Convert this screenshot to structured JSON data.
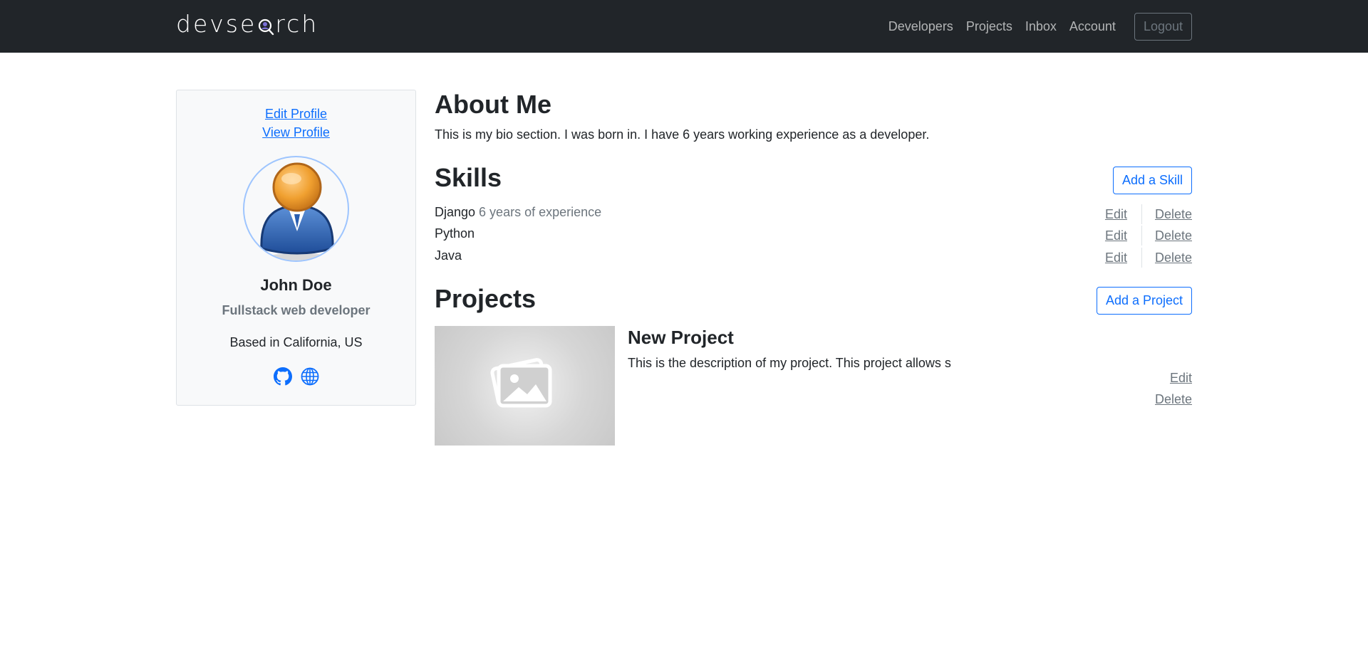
{
  "navbar": {
    "brand_left": "devse",
    "brand_right": "rch",
    "links": [
      "Developers",
      "Projects",
      "Inbox",
      "Account"
    ],
    "logout_label": "Logout"
  },
  "profile": {
    "edit_link": "Edit Profile",
    "view_link": "View Profile",
    "name": "John Doe",
    "title": "Fullstack web developer",
    "location": "Based in California, US",
    "social_icons": [
      "github-icon",
      "globe-icon"
    ]
  },
  "about": {
    "heading": "About Me",
    "bio": "This is my bio section. I was born in. I have 6 years working experience as a developer."
  },
  "skills": {
    "heading": "Skills",
    "add_label": "Add a Skill",
    "edit_label": "Edit",
    "delete_label": "Delete",
    "items": [
      {
        "name": "Django",
        "description": "6 years of experience"
      },
      {
        "name": "Python",
        "description": ""
      },
      {
        "name": "Java",
        "description": ""
      }
    ]
  },
  "projects": {
    "heading": "Projects",
    "add_label": "Add a Project",
    "edit_label": "Edit",
    "delete_label": "Delete",
    "items": [
      {
        "title": "New Project",
        "description": "This is the description of my project. This project allows s"
      }
    ]
  },
  "colors": {
    "navbar_bg": "#212529",
    "primary": "#0d6efd",
    "muted": "#6c757d"
  }
}
